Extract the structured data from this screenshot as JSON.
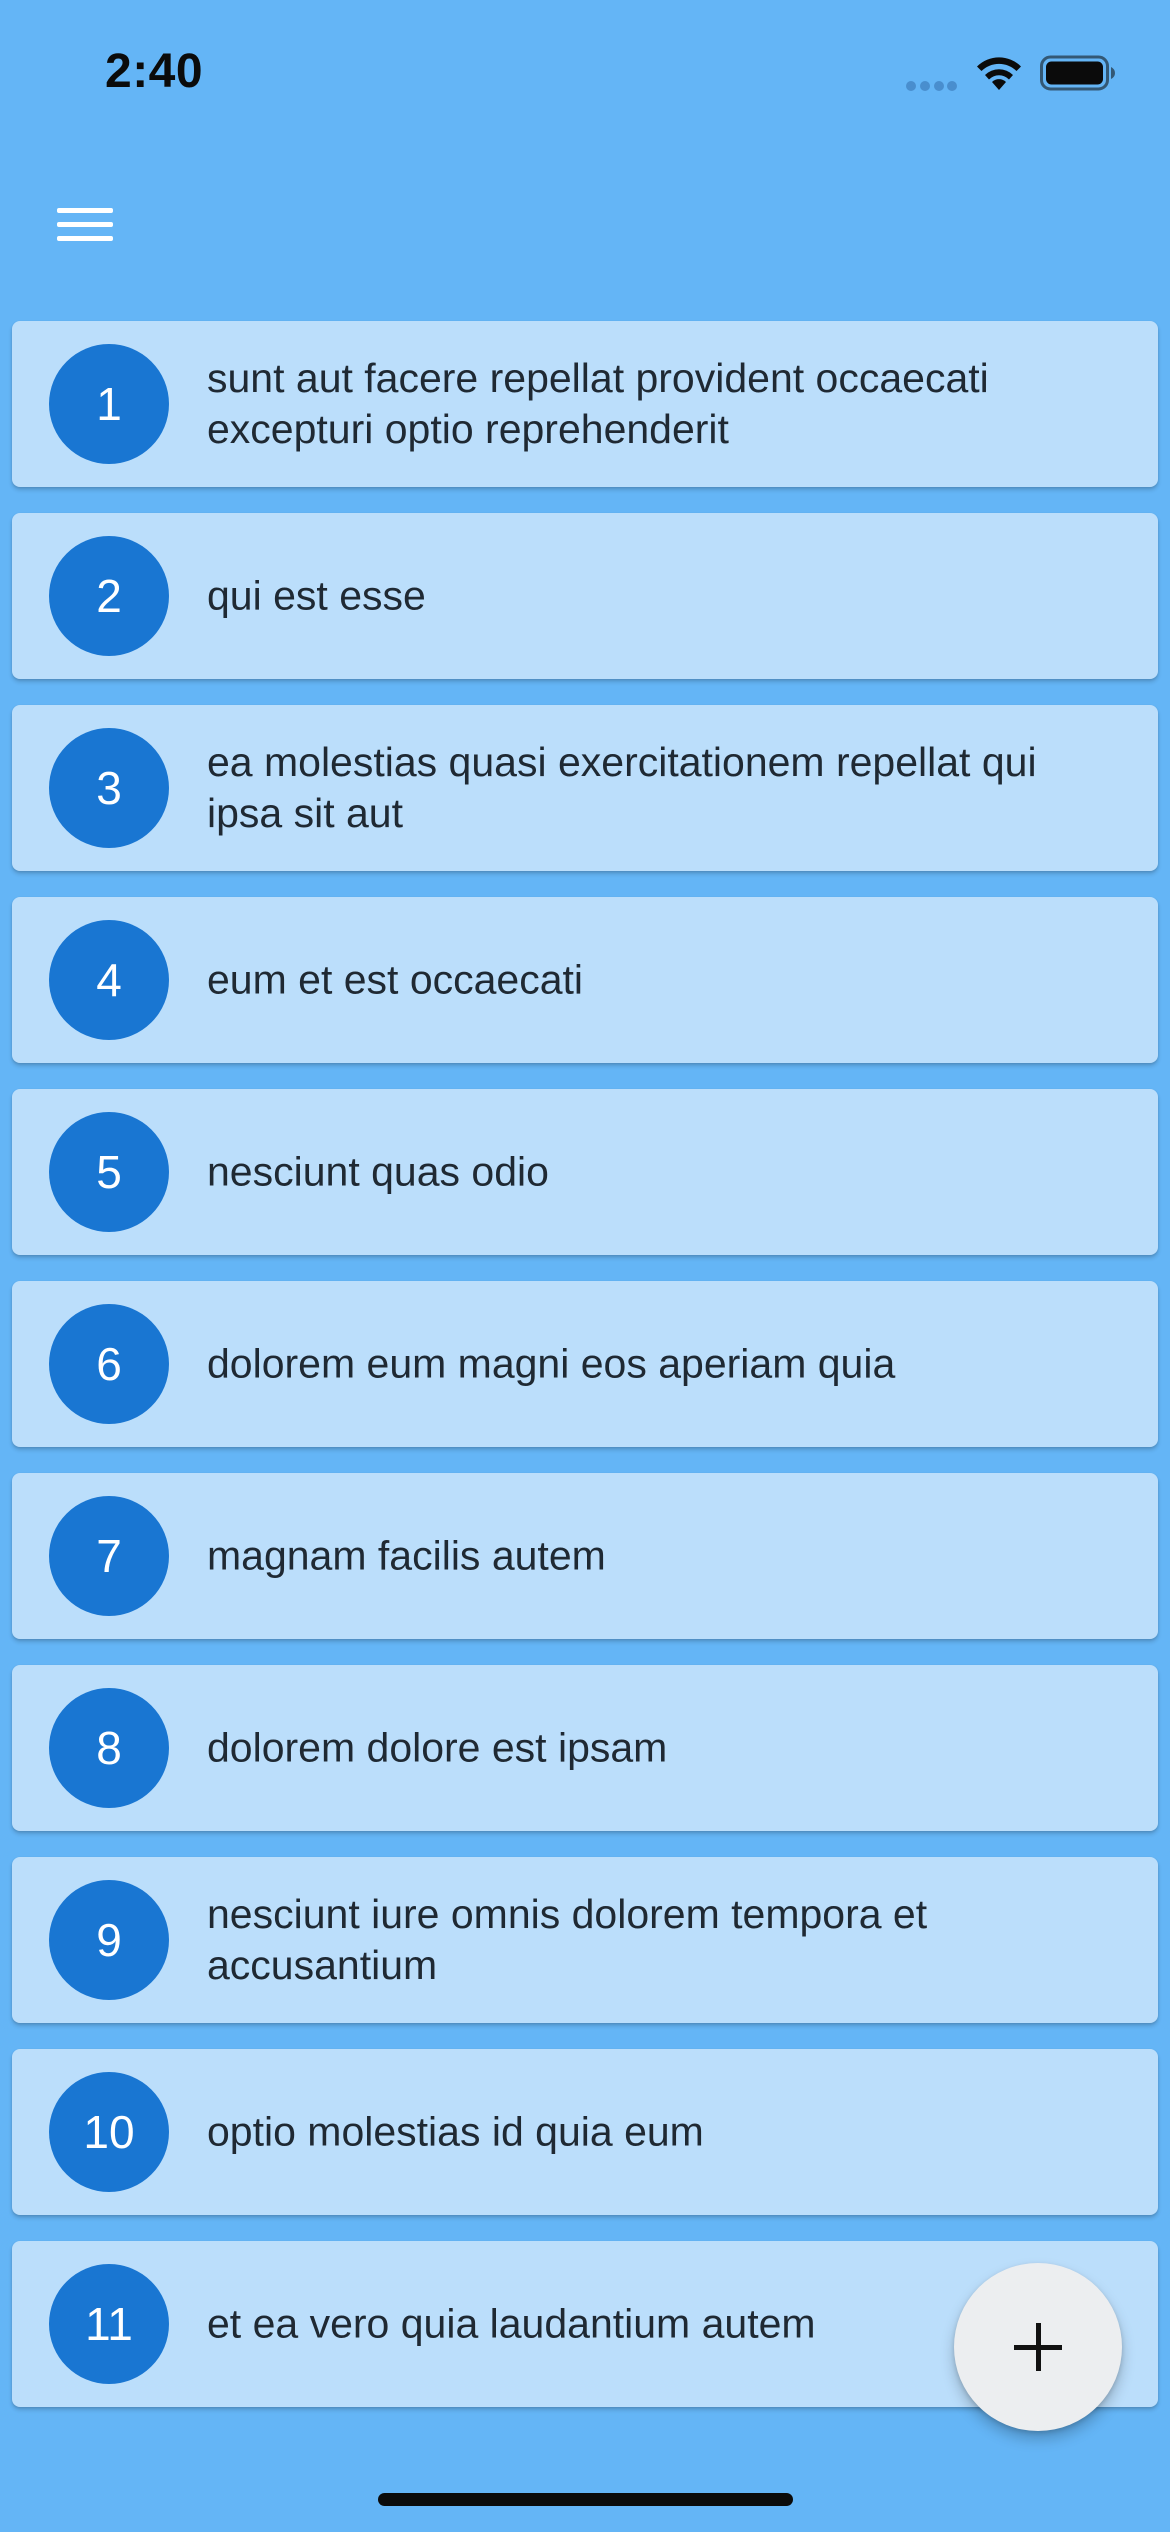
{
  "status_bar": {
    "time": "2:40",
    "icons": [
      "signal-icon",
      "wifi-icon",
      "battery-icon"
    ]
  },
  "app_bar": {
    "menu_icon": "menu-icon"
  },
  "posts": [
    {
      "id": "1",
      "title": "sunt aut facere repellat provident occaecati excepturi optio reprehenderit"
    },
    {
      "id": "2",
      "title": "qui est esse"
    },
    {
      "id": "3",
      "title": "ea molestias quasi exercitationem repellat qui ipsa sit aut"
    },
    {
      "id": "4",
      "title": "eum et est occaecati"
    },
    {
      "id": "5",
      "title": "nesciunt quas odio"
    },
    {
      "id": "6",
      "title": "dolorem eum magni eos aperiam quia"
    },
    {
      "id": "7",
      "title": "magnam facilis autem"
    },
    {
      "id": "8",
      "title": "dolorem dolore est ipsam"
    },
    {
      "id": "9",
      "title": "nesciunt iure omnis dolorem tempora et accusantium"
    },
    {
      "id": "10",
      "title": "optio molestias id quia eum"
    },
    {
      "id": "11",
      "title": "et ea vero quia laudantium autem"
    }
  ],
  "fab": {
    "icon": "plus-icon"
  },
  "colors": {
    "background": "#64B5F6",
    "card": "#BBDEFB",
    "avatar": "#1976D2",
    "fab": "#ECEEF0"
  }
}
